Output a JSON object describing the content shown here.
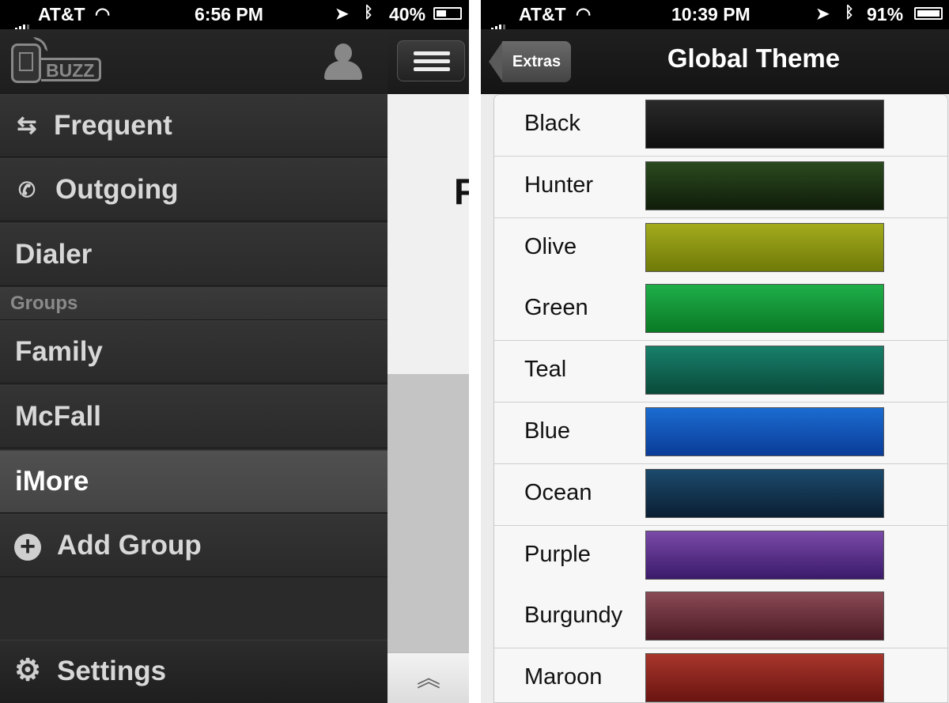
{
  "left_screen": {
    "status": {
      "carrier": "AT&T",
      "time": "6:56 PM",
      "battery": "40%"
    },
    "logo_text": "BUZZ",
    "menu": [
      {
        "label": "Frequent",
        "icon": "swap-arrows-icon"
      },
      {
        "label": "Outgoing",
        "icon": "phone-outgoing-icon"
      },
      {
        "label": "Dialer"
      }
    ],
    "groups_header": "Groups",
    "groups": [
      {
        "label": "Family"
      },
      {
        "label": "McFall"
      },
      {
        "label": "iMore",
        "selected": true
      }
    ],
    "add_group": "Add Group",
    "settings": "Settings",
    "peek_text": "F"
  },
  "right_screen": {
    "status": {
      "carrier": "AT&T",
      "time": "10:39 PM",
      "battery": "91%"
    },
    "back_label": "Extras",
    "title": "Global Theme",
    "themes": [
      {
        "name": "Black",
        "top": "#2a2a2a",
        "bottom": "#0e0e0e"
      },
      {
        "name": "Hunter",
        "top": "#2b4a1f",
        "bottom": "#101d0a"
      },
      {
        "name": "Olive",
        "top": "#a3ab1c",
        "bottom": "#6f7a09"
      },
      {
        "name": "Green",
        "top": "#1fae4a",
        "bottom": "#0a7a24"
      },
      {
        "name": "Teal",
        "top": "#17806a",
        "bottom": "#0a4a3a"
      },
      {
        "name": "Blue",
        "top": "#1b6cd1",
        "bottom": "#0a3c98"
      },
      {
        "name": "Ocean",
        "top": "#1c4a6c",
        "bottom": "#0a1f33"
      },
      {
        "name": "Purple",
        "top": "#7a4aa8",
        "bottom": "#3a1a6a"
      },
      {
        "name": "Burgundy",
        "top": "#8a4a55",
        "bottom": "#4a1a24"
      },
      {
        "name": "Maroon",
        "top": "#a8362c",
        "bottom": "#6a1410"
      }
    ]
  }
}
